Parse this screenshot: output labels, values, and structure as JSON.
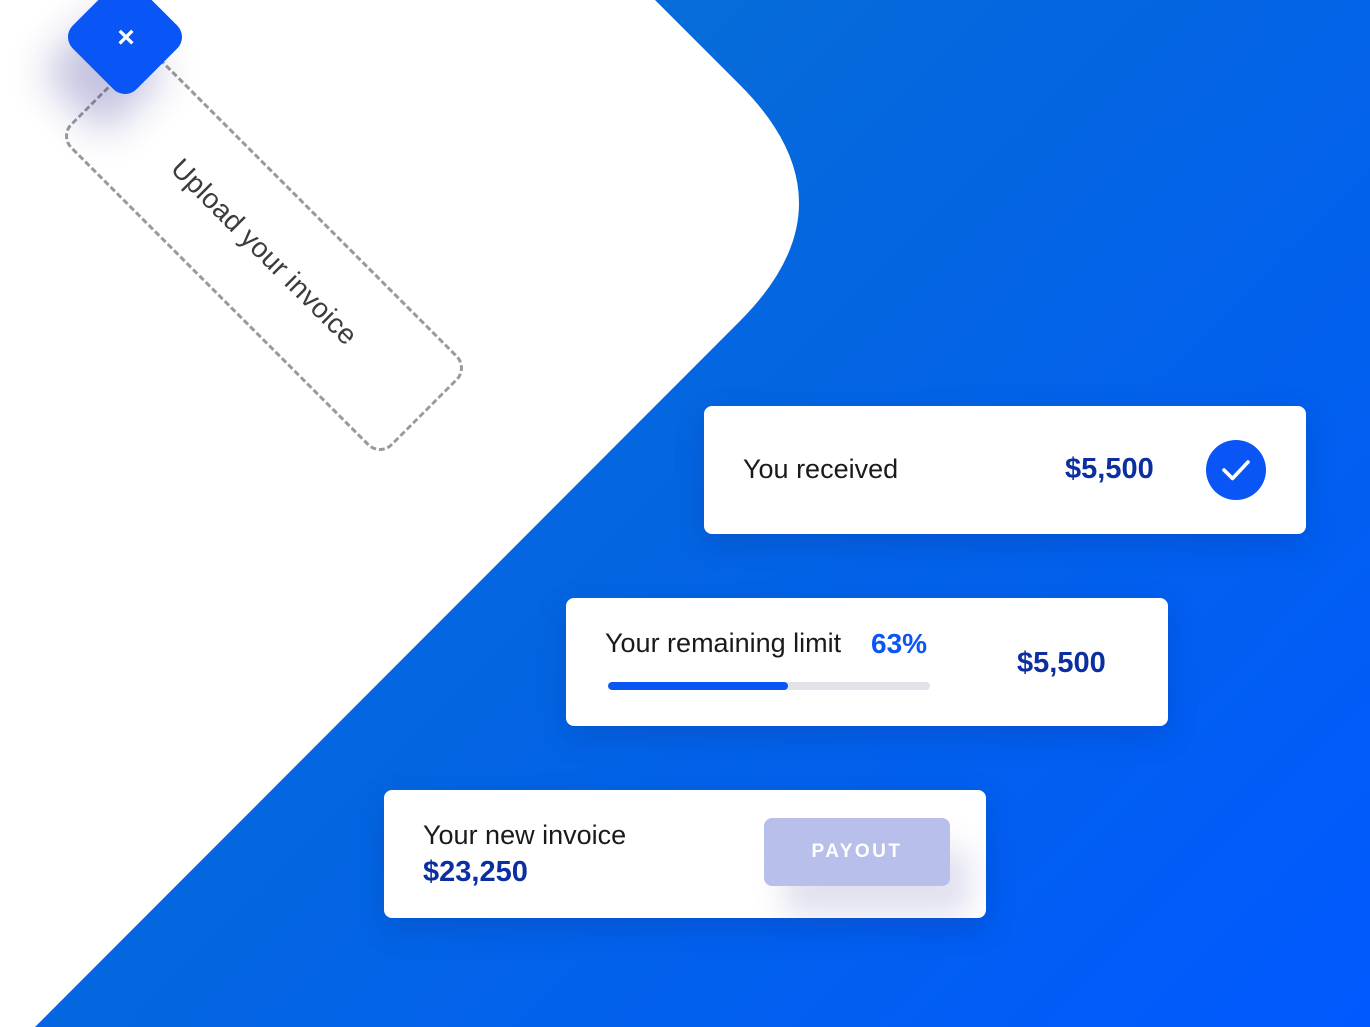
{
  "colors": {
    "brand_blue": "#0a55f5",
    "amount_navy": "#0b2ea0",
    "payout_disabled": "#b8bfea",
    "background_gradient": [
      "#0a78cc",
      "#0059ff"
    ]
  },
  "upload": {
    "label": "Upload your invoice",
    "close_icon": "close-icon",
    "close_glyph": "×"
  },
  "received_card": {
    "label": "You received",
    "amount": "$5,500",
    "status_icon": "checkmark-icon"
  },
  "limit_card": {
    "label": "Your remaining limit",
    "percent_text": "63%",
    "progress_fraction": 0.56,
    "amount": "$5,500"
  },
  "invoice_card": {
    "label": "Your new invoice",
    "amount": "$23,250",
    "payout_label": "PAYOUT"
  }
}
